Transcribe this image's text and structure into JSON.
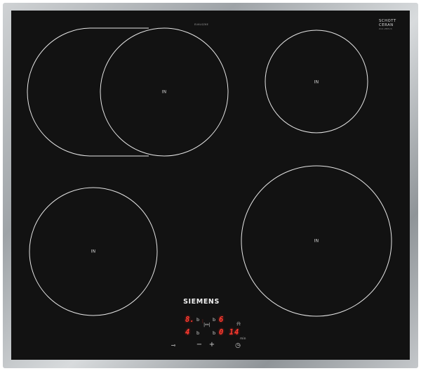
{
  "model_number": "EU6LSZ6E",
  "schott": {
    "line1": "SCHOTT",
    "line2": "CERAN",
    "sub": "ZA4-ZB6V4"
  },
  "brand": "SIEMENS",
  "zones": [
    {
      "name": "flex-front-left",
      "label": "IN"
    },
    {
      "name": "top-right",
      "label": "IN"
    },
    {
      "name": "bottom-left",
      "label": "IN"
    },
    {
      "name": "bottom-right",
      "label": "IN"
    }
  ],
  "display": {
    "row1_left_digit": "8.",
    "row1_left_sub": "b",
    "row1_right_sub": "b",
    "row1_right_digit": "6",
    "row2_left_digit": "4",
    "row2_left_sub": "b",
    "row2_right_sub": "b",
    "timer": "0 14",
    "timer_unit": "min"
  },
  "controls": {
    "minus": "−",
    "plus": "+"
  },
  "colors": {
    "glass": "#121212",
    "display_red": "#ff3b30",
    "ring": "#e6e6e6"
  }
}
